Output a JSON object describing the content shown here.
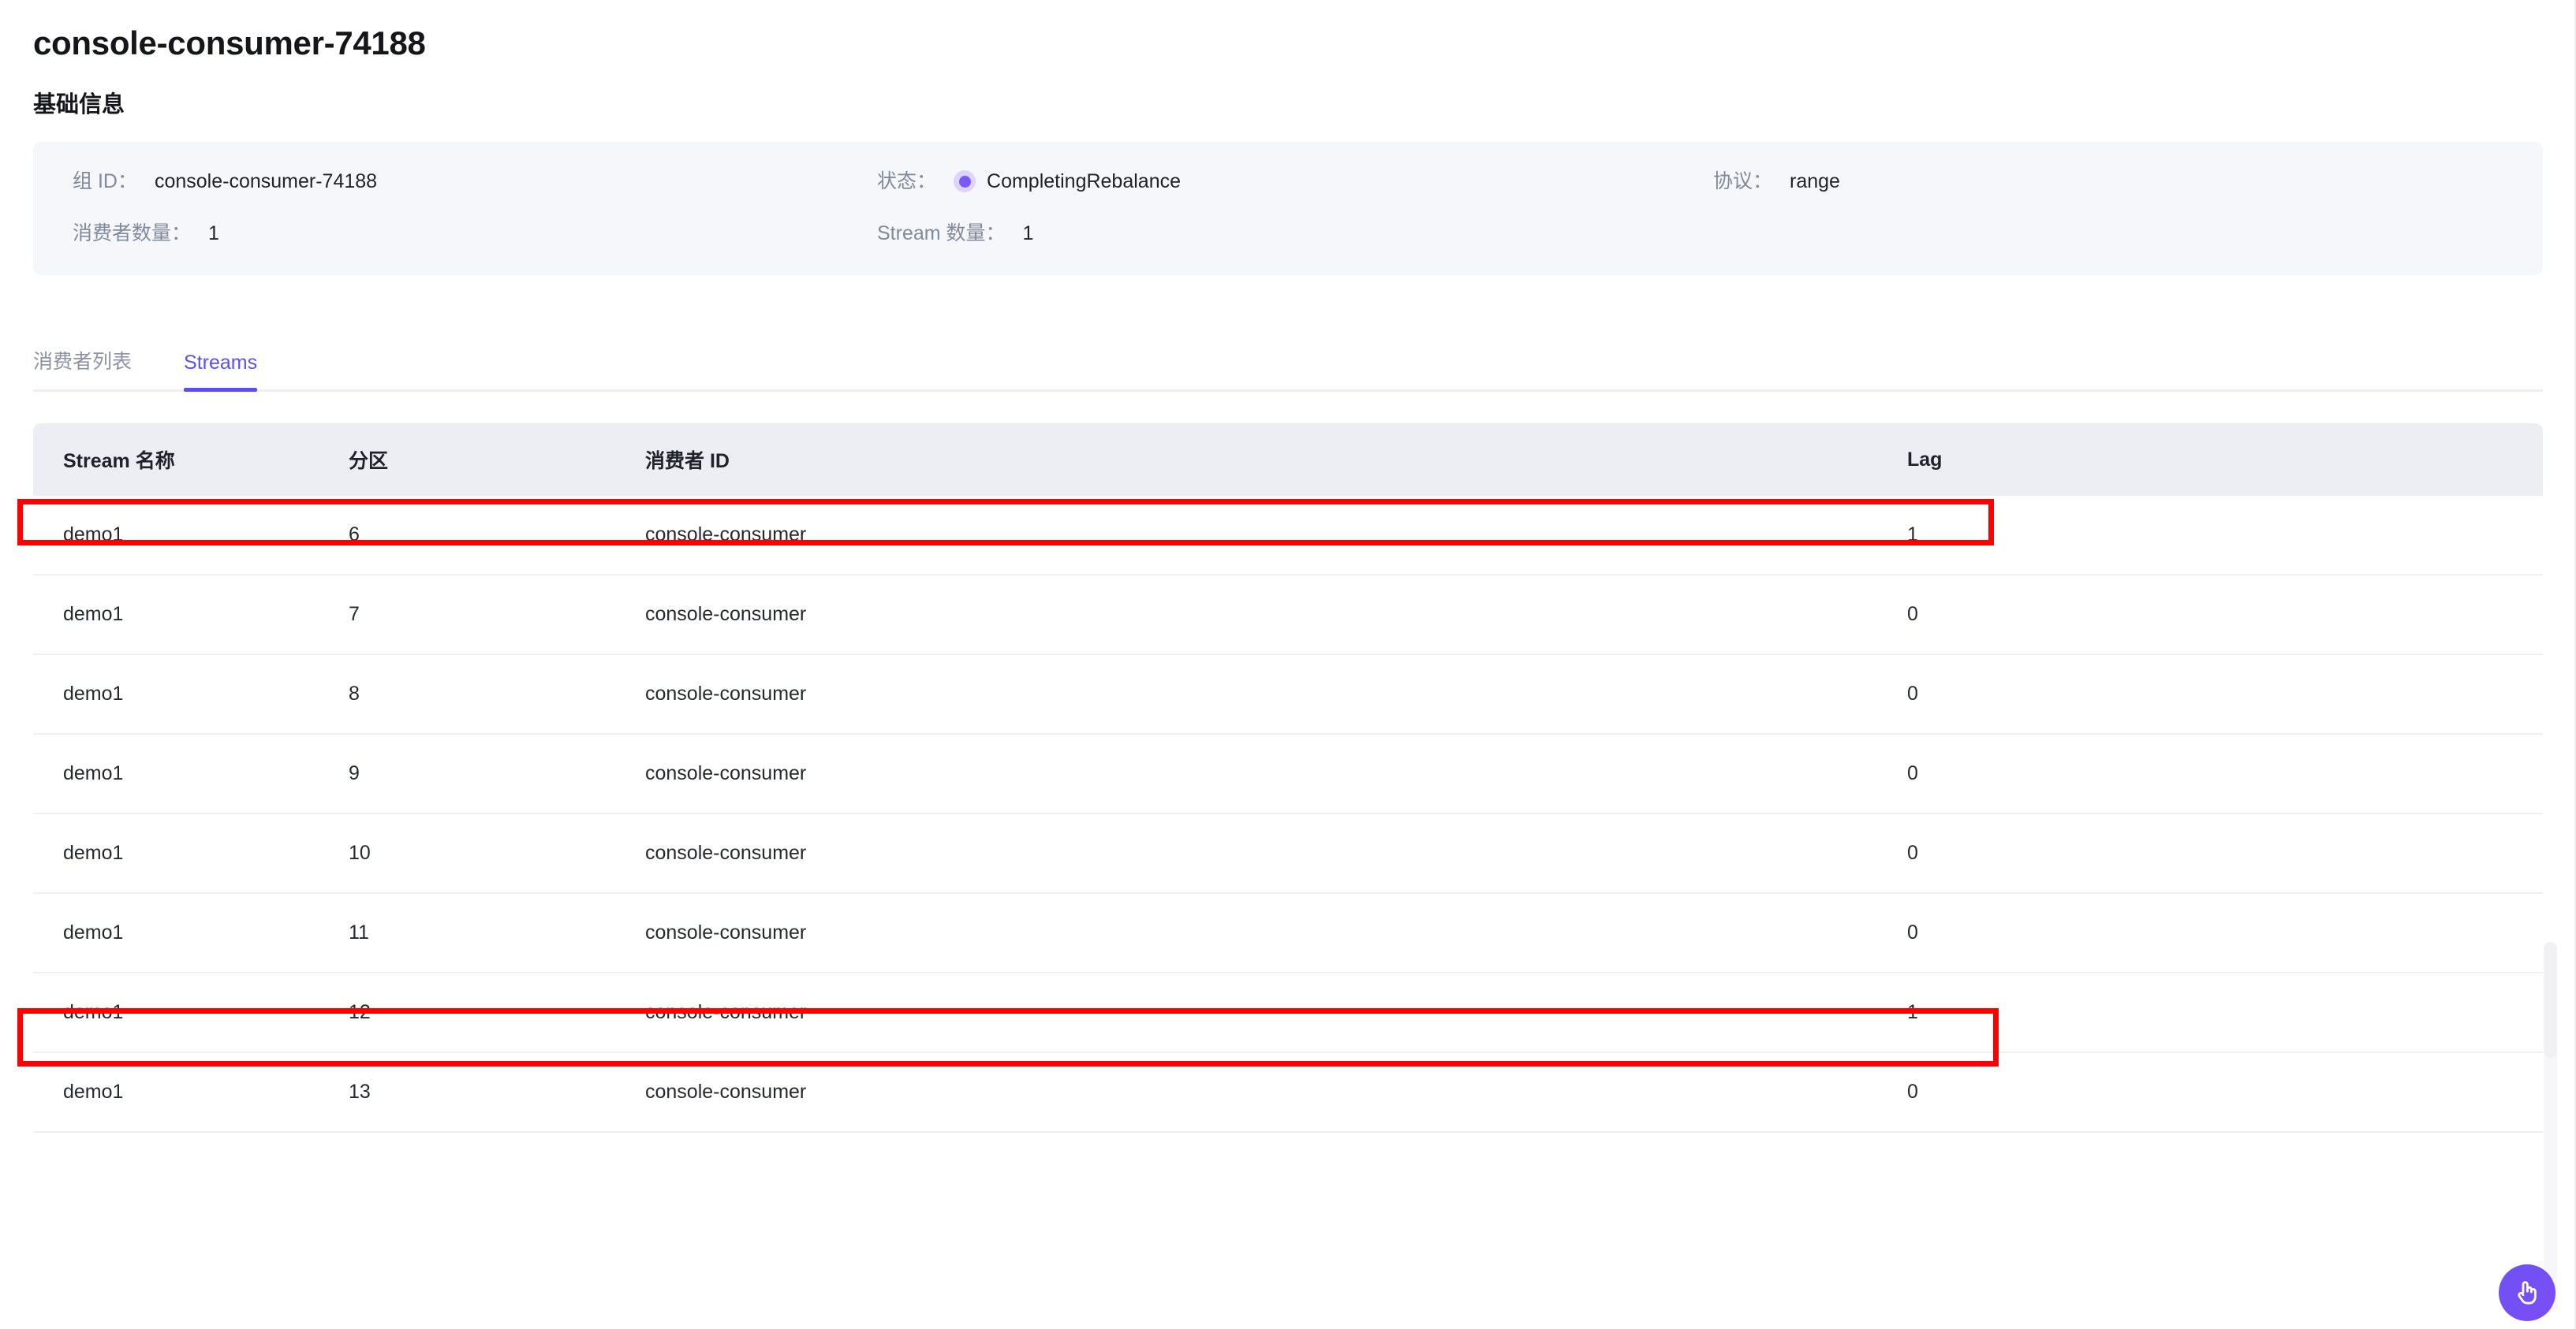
{
  "page": {
    "title": "console-consumer-74188",
    "section_heading": "基础信息"
  },
  "info": {
    "group_id_label": "组 ID：",
    "group_id_value": "console-consumer-74188",
    "state_label": "状态：",
    "state_value": "CompletingRebalance",
    "protocol_label": "协议：",
    "protocol_value": "range",
    "consumer_count_label": "消费者数量：",
    "consumer_count_value": "1",
    "stream_count_label": "Stream 数量：",
    "stream_count_value": "1"
  },
  "tabs": [
    {
      "label": "消费者列表",
      "active": false
    },
    {
      "label": "Streams",
      "active": true
    }
  ],
  "table": {
    "columns": [
      "Stream 名称",
      "分区",
      "消费者 ID",
      "Lag"
    ],
    "rows": [
      {
        "name": "demo1",
        "partition": "6",
        "consumer_id": "console-consumer",
        "lag": "1",
        "highlighted": true
      },
      {
        "name": "demo1",
        "partition": "7",
        "consumer_id": "console-consumer",
        "lag": "0",
        "highlighted": false
      },
      {
        "name": "demo1",
        "partition": "8",
        "consumer_id": "console-consumer",
        "lag": "0",
        "highlighted": false
      },
      {
        "name": "demo1",
        "partition": "9",
        "consumer_id": "console-consumer",
        "lag": "0",
        "highlighted": false
      },
      {
        "name": "demo1",
        "partition": "10",
        "consumer_id": "console-consumer",
        "lag": "0",
        "highlighted": false
      },
      {
        "name": "demo1",
        "partition": "11",
        "consumer_id": "console-consumer",
        "lag": "0",
        "highlighted": false
      },
      {
        "name": "demo1",
        "partition": "12",
        "consumer_id": "console-consumer",
        "lag": "1",
        "highlighted": true
      },
      {
        "name": "demo1",
        "partition": "13",
        "consumer_id": "console-consumer",
        "lag": "0",
        "highlighted": false
      }
    ]
  },
  "colors": {
    "accent_purple": "#5b4ff0",
    "status_dot": "#7a5af5",
    "status_dot_halo": "#ded3fb",
    "highlight_red": "#fe0000",
    "panel_bg": "#f6f7fb",
    "table_header_bg": "#eceef4"
  },
  "fab": {
    "icon": "click-hand-icon"
  }
}
